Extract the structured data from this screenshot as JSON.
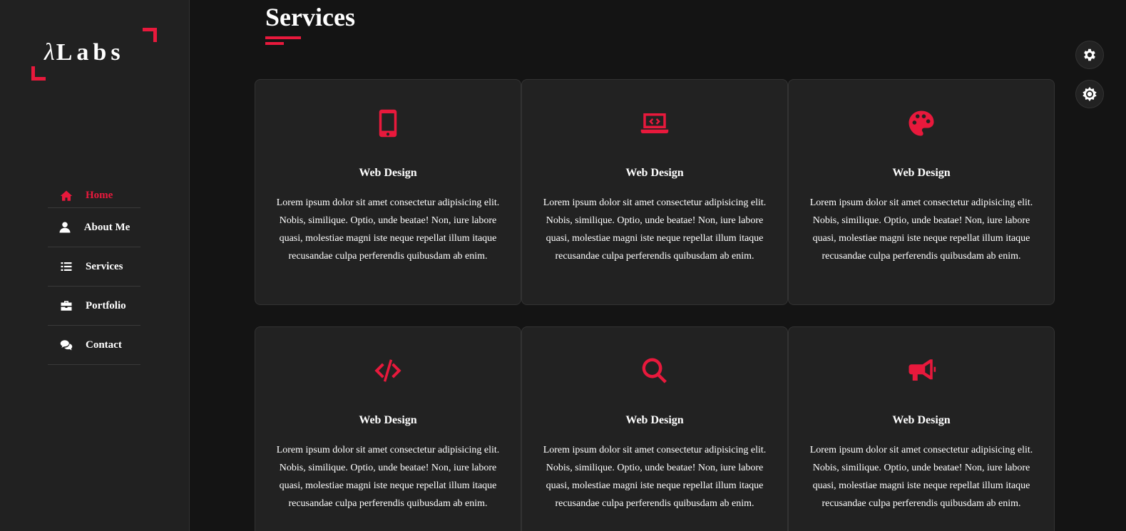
{
  "logo": {
    "lambda": "λ",
    "text": "Labs"
  },
  "nav": [
    {
      "label": "Home",
      "icon": "home-icon",
      "active": true
    },
    {
      "label": "About Me",
      "icon": "user-icon",
      "active": false
    },
    {
      "label": "Services",
      "icon": "list-icon",
      "active": false
    },
    {
      "label": "Portfolio",
      "icon": "briefcase-icon",
      "active": false
    },
    {
      "label": "Contact",
      "icon": "comments-icon",
      "active": false
    }
  ],
  "section": {
    "title": "Services"
  },
  "cards": [
    {
      "icon": "mobile-icon",
      "title": "Web Design",
      "text": "Lorem ipsum dolor sit amet consectetur adipisicing elit. Nobis, similique. Optio, unde beatae! Non, iure labore quasi, molestiae magni iste neque repellat illum itaque recusandae culpa perferendis quibusdam ab enim."
    },
    {
      "icon": "laptop-code-icon",
      "title": "Web Design",
      "text": "Lorem ipsum dolor sit amet consectetur adipisicing elit. Nobis, similique. Optio, unde beatae! Non, iure labore quasi, molestiae magni iste neque repellat illum itaque recusandae culpa perferendis quibusdam ab enim."
    },
    {
      "icon": "palette-icon",
      "title": "Web Design",
      "text": "Lorem ipsum dolor sit amet consectetur adipisicing elit. Nobis, similique. Optio, unde beatae! Non, iure labore quasi, molestiae magni iste neque repellat illum itaque recusandae culpa perferendis quibusdam ab enim."
    },
    {
      "icon": "code-icon",
      "title": "Web Design",
      "text": "Lorem ipsum dolor sit amet consectetur adipisicing elit. Nobis, similique. Optio, unde beatae! Non, iure labore quasi, molestiae magni iste neque repellat illum itaque recusandae culpa perferendis quibusdam ab enim."
    },
    {
      "icon": "search-icon",
      "title": "Web Design",
      "text": "Lorem ipsum dolor sit amet consectetur adipisicing elit. Nobis, similique. Optio, unde beatae! Non, iure labore quasi, molestiae magni iste neque repellat illum itaque recusandae culpa perferendis quibusdam ab enim."
    },
    {
      "icon": "bullhorn-icon",
      "title": "Web Design",
      "text": "Lorem ipsum dolor sit amet consectetur adipisicing elit. Nobis, similique. Optio, unde beatae! Non, iure labore quasi, molestiae magni iste neque repellat illum itaque recusandae culpa perferendis quibusdam ab enim."
    }
  ],
  "floating_buttons": [
    {
      "icon": "gear-icon"
    },
    {
      "icon": "sun-icon"
    }
  ],
  "colors": {
    "accent": "#e8193c",
    "background": "#141414",
    "sidebar": "#212121",
    "card": "#222222"
  }
}
